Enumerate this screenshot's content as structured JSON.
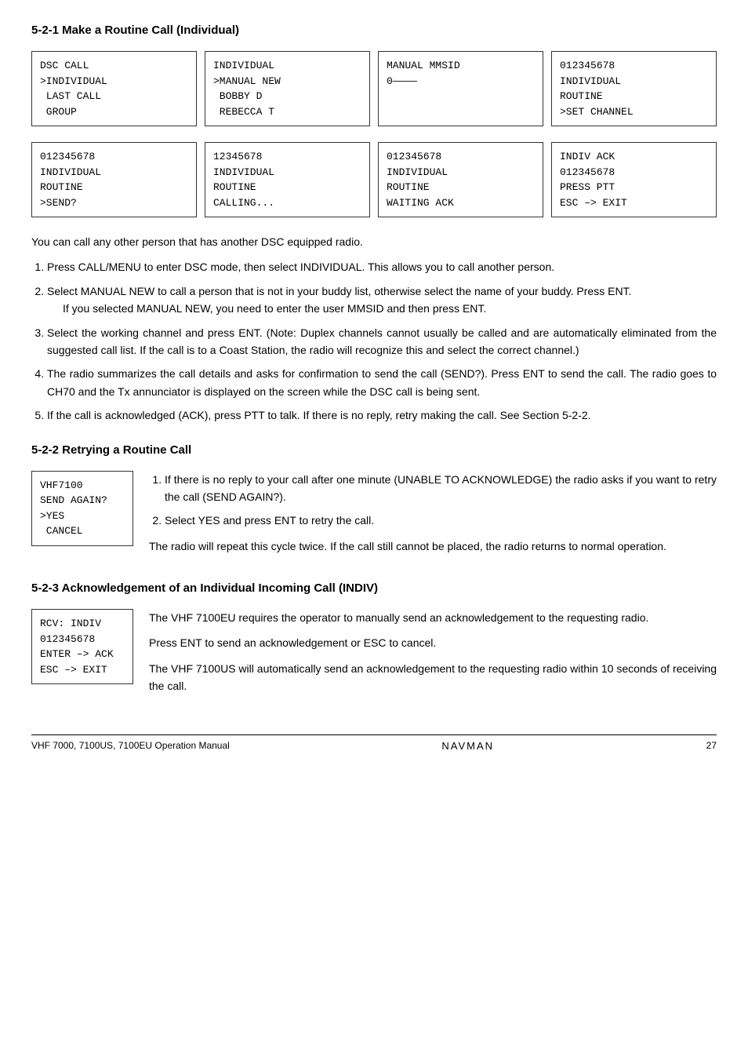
{
  "page": {
    "title": "5-2-1 Make a Routine Call (Individual)",
    "section1": {
      "screens": [
        {
          "lines": [
            "DSC CALL",
            ">INDIVIDUAL",
            " LAST CALL",
            " GROUP"
          ]
        },
        {
          "lines": [
            "INDIVIDUAL",
            ">MANUAL NEW",
            " BOBBY D",
            " REBECCA T"
          ]
        },
        {
          "lines": [
            "MANUAL MMSID",
            "0————————"
          ]
        },
        {
          "lines": [
            "012345678",
            "INDIVIDUAL",
            "ROUTINE",
            ">SET CHANNEL"
          ]
        }
      ],
      "screens_row2": [
        {
          "lines": [
            "012345678",
            "INDIVIDUAL",
            "ROUTINE",
            ">SEND?"
          ]
        },
        {
          "lines": [
            "12345678",
            "INDIVIDUAL",
            "ROUTINE",
            "CALLING..."
          ]
        },
        {
          "lines": [
            "012345678",
            "INDIVIDUAL",
            "ROUTINE",
            "WAITING ACK"
          ]
        },
        {
          "lines": [
            "INDIV ACK",
            "012345678",
            "PRESS PTT",
            "ESC –> EXIT"
          ]
        }
      ]
    },
    "intro_text": "You can call any other person that has another DSC equipped radio.",
    "steps": [
      "Press CALL/MENU to enter DSC mode, then select INDIVIDUAL. This allows you to call another person.",
      "Select MANUAL NEW to call a person that is not in your buddy list, otherwise select the name of your buddy. Press ENT.",
      "Select the working channel and press ENT. (Note: Duplex channels cannot usually be called and are automatically eliminated from the suggested call list. If the call is to a Coast Station, the radio will recognize this and select the correct channel.)",
      "The radio summarizes the call details and asks for confirmation to send the call (SEND?). Press ENT to send the call. The radio goes to CH70 and the Tx annunciator is displayed on the screen while the DSC call is being sent.",
      "If the call is acknowledged (ACK), press PTT to talk. If there is no reply, retry making the call. See Section 5-2-2."
    ],
    "indent_para": "If you selected MANUAL NEW, you need to enter the user MMSID and then press ENT.",
    "section2": {
      "title": "5-2-2 Retrying a Routine Call",
      "screen": {
        "lines": [
          "VHF7100",
          "SEND AGAIN?",
          ">YES",
          " CANCEL"
        ]
      },
      "steps": [
        "If there is no reply to your call after one minute (UNABLE TO ACKNOWLEDGE) the radio asks if you want to retry the call (SEND AGAIN?).",
        "Select YES and press ENT to retry the call."
      ],
      "para": "The radio will repeat this cycle twice. If the call still cannot be placed, the radio returns to normal operation."
    },
    "section3": {
      "title": "5-2-3 Acknowledgement of an Individual Incoming Call (INDIV)",
      "screen": {
        "lines": [
          "RCV: INDIV",
          "012345678",
          "ENTER –> ACK",
          "ESC –> EXIT"
        ]
      },
      "para1": "The VHF 7100EU requires the operator to manually send an acknowledgement to the requesting radio.",
      "para2": "Press ENT to send an acknowledgement or ESC to cancel.",
      "para3": "The VHF 7100US will automatically send an acknowledgement to the requesting radio within 10 seconds of receiving the call."
    },
    "footer": {
      "left": "VHF 7000, 7100US, 7100EU Operation Manual",
      "center": "NAVMAN",
      "right": "27"
    }
  }
}
